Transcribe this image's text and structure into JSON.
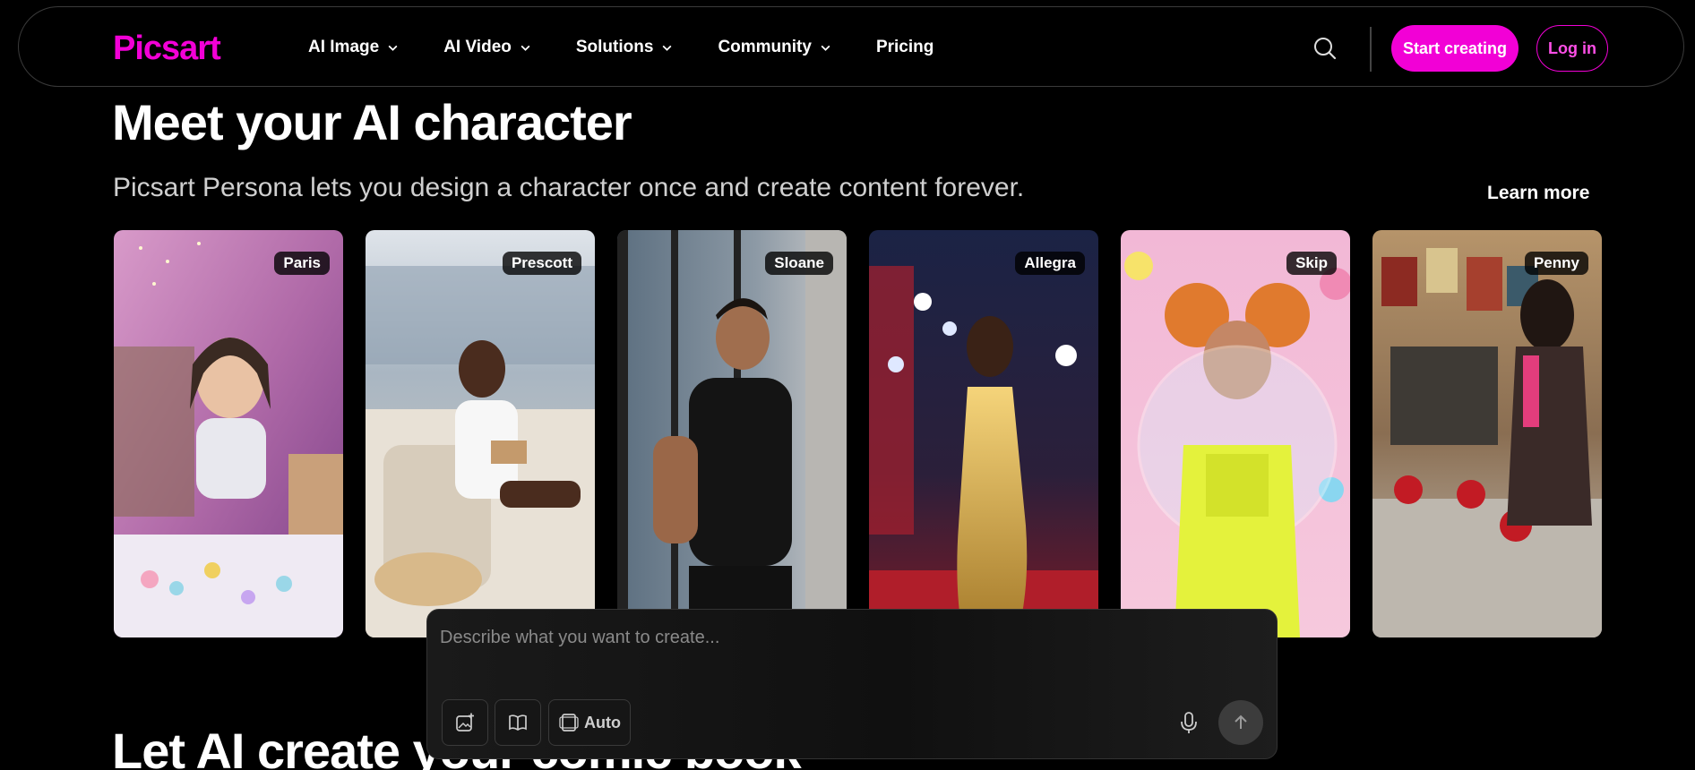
{
  "brand": {
    "name": "Picsart",
    "accent": "#f200d6"
  },
  "nav": {
    "items": [
      {
        "label": "AI Image",
        "has_dropdown": true
      },
      {
        "label": "AI Video",
        "has_dropdown": true
      },
      {
        "label": "Solutions",
        "has_dropdown": true
      },
      {
        "label": "Community",
        "has_dropdown": true
      },
      {
        "label": "Pricing",
        "has_dropdown": false
      }
    ],
    "search_icon": "search-icon",
    "start_label": "Start creating",
    "login_label": "Log in"
  },
  "hero": {
    "title": "Meet your AI character",
    "subtitle": "Picsart Persona lets you design a character once and create content forever.",
    "learn_more": "Learn more"
  },
  "personas": [
    {
      "name": "Paris"
    },
    {
      "name": "Prescott"
    },
    {
      "name": "Sloane"
    },
    {
      "name": "Allegra"
    },
    {
      "name": "Skip"
    },
    {
      "name": "Penny"
    }
  ],
  "next_section": {
    "title": "Let AI create your comic book"
  },
  "prompt": {
    "placeholder": "Describe what you want to create...",
    "auto_label": "Auto",
    "icons": [
      "image-add-icon",
      "book-icon",
      "aspect-ratio-icon",
      "microphone-icon",
      "arrow-up-icon"
    ]
  }
}
